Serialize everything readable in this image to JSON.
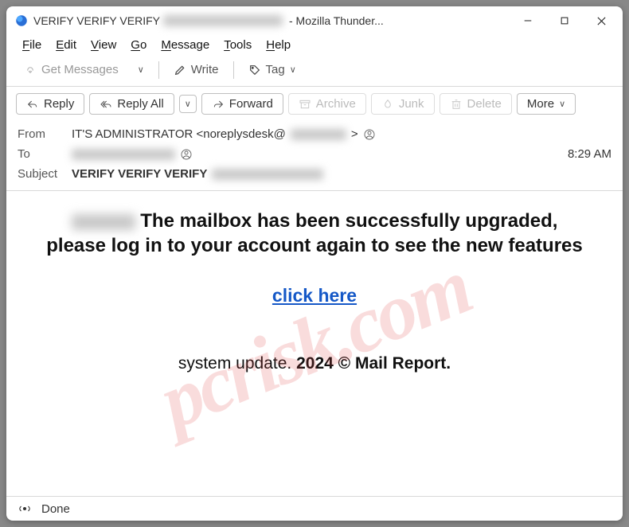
{
  "titlebar": {
    "title_prefix": "VERIFY VERIFY VERIFY",
    "title_suffix": " - Mozilla Thunder..."
  },
  "menubar": {
    "file": "File",
    "edit": "Edit",
    "view": "View",
    "go": "Go",
    "message": "Message",
    "tools": "Tools",
    "help": "Help"
  },
  "toolbar1": {
    "get_messages": "Get Messages",
    "write": "Write",
    "tag": "Tag"
  },
  "toolbar2": {
    "reply": "Reply",
    "reply_all": "Reply All",
    "forward": "Forward",
    "archive": "Archive",
    "junk": "Junk",
    "delete": "Delete",
    "more": "More"
  },
  "headers": {
    "from_label": "From",
    "from_value_pre": "IT'S ADMINISTRATOR <noreplysdesk@",
    "from_value_post": ">",
    "to_label": "To",
    "subject_label": "Subject",
    "subject_value": "VERIFY VERIFY VERIFY",
    "time": "8:29 AM"
  },
  "body": {
    "main_line1": "The mailbox has been successfully upgraded,",
    "main_line2": "please log in to your account again to see the new features",
    "link": "click here ",
    "footer_plain": "system update. ",
    "footer_bold": "2024 © Mail Report."
  },
  "statusbar": {
    "done": "Done"
  },
  "watermark": "pcrisk.com"
}
